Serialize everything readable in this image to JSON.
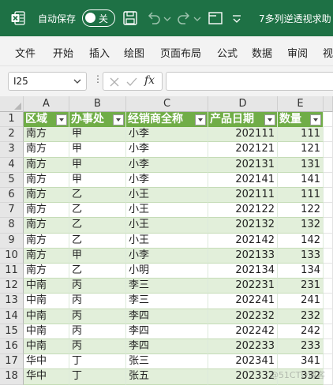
{
  "titlebar": {
    "autosave_label": "自动保存",
    "autosave_state": "关",
    "doc_title": "7多列逆透视求助",
    "color": "#1e7145"
  },
  "menu": [
    "文件",
    "开始",
    "插入",
    "绘图",
    "页面布局",
    "公式",
    "数据",
    "审阅",
    "视"
  ],
  "formula_bar": {
    "name_box": "I25",
    "fx": "fx",
    "formula_value": ""
  },
  "columns": [
    "A",
    "B",
    "C",
    "D",
    "E"
  ],
  "table": {
    "header_color": "#70ad47",
    "band_color": "#e2efda",
    "headers": [
      "区域",
      "办事处",
      "经销商全称",
      "产品日期",
      "数量"
    ],
    "rows": [
      [
        "南方",
        "甲",
        "小李",
        "202111",
        "111"
      ],
      [
        "南方",
        "甲",
        "小李",
        "202121",
        "121"
      ],
      [
        "南方",
        "甲",
        "小李",
        "202131",
        "131"
      ],
      [
        "南方",
        "甲",
        "小李",
        "202141",
        "141"
      ],
      [
        "南方",
        "乙",
        "小王",
        "202111",
        "111"
      ],
      [
        "南方",
        "乙",
        "小王",
        "202122",
        "122"
      ],
      [
        "南方",
        "乙",
        "小王",
        "202132",
        "132"
      ],
      [
        "南方",
        "乙",
        "小王",
        "202142",
        "142"
      ],
      [
        "南方",
        "甲",
        "小李",
        "202133",
        "133"
      ],
      [
        "南方",
        "乙",
        "小明",
        "202134",
        "134"
      ],
      [
        "中南",
        "丙",
        "李三",
        "202231",
        "231"
      ],
      [
        "中南",
        "丙",
        "李三",
        "202241",
        "241"
      ],
      [
        "中南",
        "丙",
        "李四",
        "202232",
        "232"
      ],
      [
        "中南",
        "丙",
        "李四",
        "202242",
        "242"
      ],
      [
        "中南",
        "丙",
        "李四",
        "202233",
        "233"
      ],
      [
        "华中",
        "丁",
        "张三",
        "202341",
        "341"
      ],
      [
        "华中",
        "丁",
        "张五",
        "202332",
        "332"
      ]
    ]
  },
  "watermark": "@51CTO博客"
}
